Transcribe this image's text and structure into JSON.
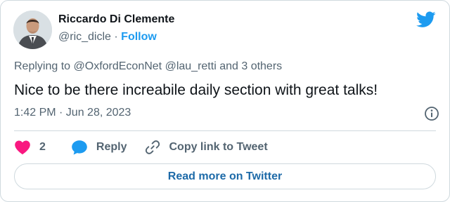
{
  "author": {
    "name": "Riccardo Di Clemente",
    "handle": "@ric_dicle",
    "separator": "·",
    "follow_label": "Follow"
  },
  "replying": {
    "prefix": "Replying to",
    "mention_1": "@OxfordEconNet",
    "mention_2": "@lau_retti",
    "suffix": "and 3 others"
  },
  "tweet": {
    "text": "Nice to be there increabile daily section with great talks!",
    "timestamp": "1:42 PM · Jun 28, 2023"
  },
  "actions": {
    "like_count": "2",
    "reply_label": "Reply",
    "copy_link_label": "Copy link to Tweet"
  },
  "read_more_label": "Read more on Twitter",
  "colors": {
    "accent": "#1d9bf0",
    "like": "#f91880",
    "text": "#0f1419",
    "muted": "#536471",
    "border": "#cfd9de"
  },
  "icons": [
    "twitter-bird-icon",
    "info-icon",
    "heart-icon",
    "reply-bubble-icon",
    "link-icon"
  ]
}
